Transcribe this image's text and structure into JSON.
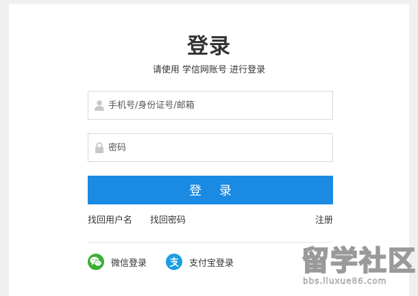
{
  "login": {
    "title": "登录",
    "subtitle": "请使用 学信网账号 进行登录",
    "username_placeholder": "手机号/身份证号/邮箱",
    "password_placeholder": "密码",
    "submit_label": "登 录",
    "forgot_username": "找回用户名",
    "forgot_password": "找回密码",
    "register": "注册",
    "wechat_login": "微信登录",
    "alipay_login": "支付宝登录"
  },
  "icons": {
    "user": "user-icon",
    "lock": "lock-icon",
    "wechat": "wechat-icon",
    "alipay": "alipay-icon"
  },
  "colors": {
    "primary": "#1a8ae2",
    "wechat": "#3cb034",
    "alipay": "#1a9ee2"
  },
  "watermark": {
    "logo": "留学社区",
    "url": "bbs.liuxue86.com"
  }
}
